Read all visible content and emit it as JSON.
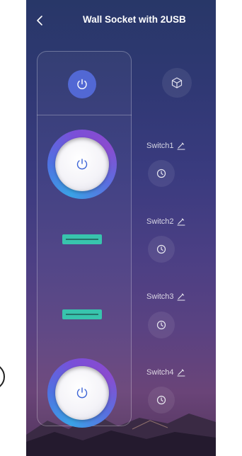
{
  "header": {
    "title": "Wall Socket with 2USB"
  },
  "switches": [
    {
      "label": "Switch1",
      "state": "on"
    },
    {
      "label": "Switch2",
      "state": "off"
    },
    {
      "label": "Switch3",
      "state": "off"
    },
    {
      "label": "Switch4",
      "state": "on"
    }
  ],
  "colors": {
    "accent": "#5268d4",
    "off_indicator": "#38c4ad"
  },
  "icons": {
    "back": "chevron-left-icon",
    "master_power": "power-icon",
    "mode": "cube-icon",
    "edit": "pencil-icon",
    "timer": "clock-icon"
  }
}
